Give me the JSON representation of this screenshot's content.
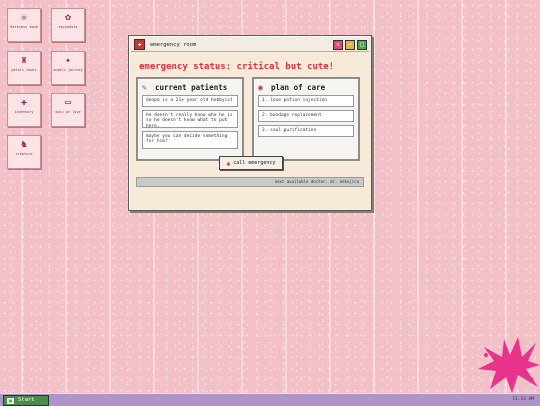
{
  "desktop_icons": [
    {
      "label": "darkness tomb",
      "icon": "skull-icon"
    },
    {
      "label": "ebyyadate",
      "icon": "gear-icon"
    },
    {
      "label": "petals tower",
      "icon": "tower-icon"
    },
    {
      "label": "angels journey",
      "icon": "sparkle-icon"
    },
    {
      "label": "inventory",
      "icon": "pills-icon"
    },
    {
      "label": "quiz of love",
      "icon": "card-icon"
    },
    {
      "label": "creature",
      "icon": "bat-icon"
    }
  ],
  "window": {
    "title": "emergency room",
    "status": "emergency status: critical but cute!",
    "patients": {
      "heading": "current patients",
      "items": [
        "denpa is a 21+ year old hobbyist",
        "he doesn't really know who he is so he doesn't know what to put here.",
        "maybe you can decide something for him?"
      ]
    },
    "plan": {
      "heading": "plan of care",
      "items": [
        "1. love potion injection",
        "2. bandage replacement",
        "3. soul purification"
      ]
    },
    "call_button": "call emergency",
    "status_bar": "next available doctor: dr. nekojiru"
  },
  "taskbar": {
    "start_label": "Start",
    "clock": "11:13 AM"
  },
  "colors": {
    "accent": "#e0303a",
    "desktop": "#f4c0c8",
    "taskbar": "#b094c8"
  }
}
